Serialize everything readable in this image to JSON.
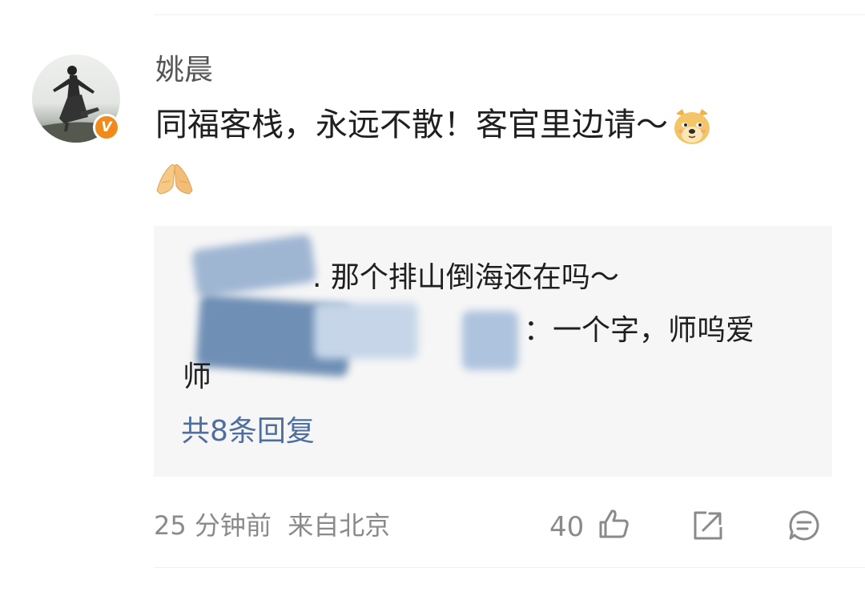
{
  "comment": {
    "username": "姚晨",
    "text": "同福客栈，永远不散！客官里边请～",
    "emoji_inline": "doge-emoji",
    "emoji_line2": "praying-hands-emoji",
    "verified_badge": "V"
  },
  "replies": {
    "line1": ". 那个排山倒海还在吗～",
    "line2": "：一个字，师呜爱",
    "line3": "师",
    "more_label": "共8条回复"
  },
  "footer": {
    "meta": "25 分钟前  来自北京",
    "like_count": "40",
    "icons": [
      "like-icon",
      "share-icon",
      "comment-icon"
    ]
  },
  "colors": {
    "link": "#4f6ea0",
    "badge": "#f08a1c",
    "reply_bg": "#f6f6f6",
    "meta_text": "#8a8a8a"
  }
}
